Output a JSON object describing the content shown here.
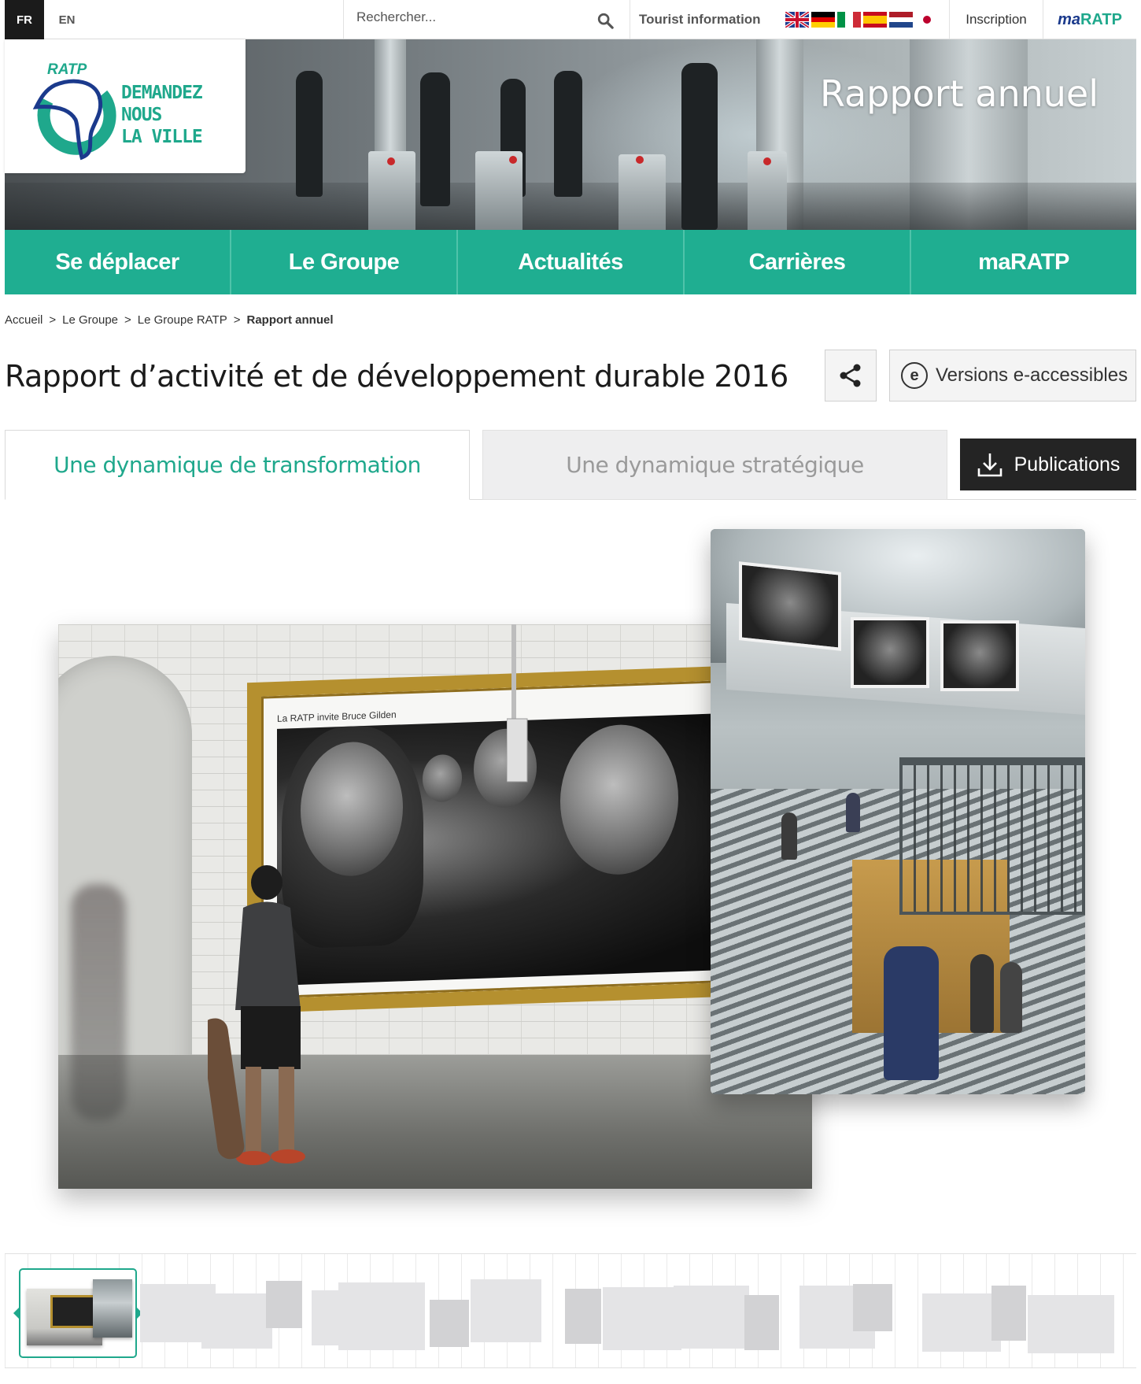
{
  "topbar": {
    "lang_fr": "FR",
    "lang_en": "EN",
    "search_placeholder": "Rechercher...",
    "tourist_info": "Tourist information",
    "flags": [
      "uk-flag",
      "de-flag",
      "it-flag",
      "es-flag",
      "nl-flag",
      "jp-flag"
    ],
    "inscription": "Inscription",
    "maratp_prefix": "ma",
    "maratp_suffix": "RATP"
  },
  "logo": {
    "brand": "RATP",
    "tagline": [
      "DEMANDEZ",
      "NOUS",
      "LA VILLE"
    ]
  },
  "hero": {
    "title": "Rapport annuel"
  },
  "nav": {
    "items": [
      "Se déplacer",
      "Le Groupe",
      "Actualités",
      "Carrières",
      "maRATP"
    ]
  },
  "breadcrumb": {
    "items": [
      "Accueil",
      "Le Groupe",
      "Le Groupe RATP"
    ],
    "current": "Rapport annuel",
    "separator": ">"
  },
  "page": {
    "title": "Rapport d’activité et de développement durable 2016",
    "accessible_label": "Versions e-accessibles",
    "accessible_icon_letter": "e"
  },
  "tabs": {
    "active": "Une dynamique de transformation",
    "inactive": "Une dynamique stratégique",
    "publications": "Publications"
  },
  "poster": {
    "caption": "La RATP invite Bruce Gilden"
  },
  "colors": {
    "brand_green": "#1fae91",
    "brand_blue": "#1b3a8c",
    "dark_button": "#242424"
  }
}
